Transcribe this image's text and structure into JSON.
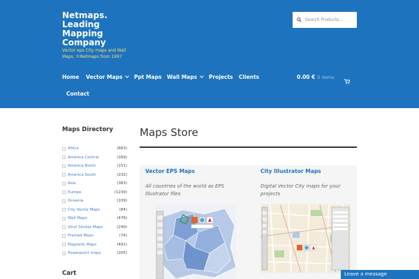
{
  "header": {
    "site_title": "Netmaps. Leading Mapping Company",
    "site_description": "Vector eps City maps and Wall Maps. ©Netmaps from 1997",
    "search_placeholder": "Search Products…"
  },
  "nav": {
    "items": [
      {
        "label": "Home"
      },
      {
        "label": "Vector Maps"
      },
      {
        "label": "Ppt Maps"
      },
      {
        "label": "Wall Maps"
      },
      {
        "label": "Projects"
      },
      {
        "label": "Clients"
      },
      {
        "label": "Contact"
      }
    ],
    "cart_total": "0.00 €",
    "cart_items": "0 items"
  },
  "sidebar": {
    "title": "Maps Directory",
    "categories": [
      {
        "name": "Africa",
        "count": "(663)"
      },
      {
        "name": "America Central",
        "count": "(169)"
      },
      {
        "name": "America North",
        "count": "(151)"
      },
      {
        "name": "America South",
        "count": "(232)"
      },
      {
        "name": "Asia",
        "count": "(363)"
      },
      {
        "name": "Europe",
        "count": "(1239)"
      },
      {
        "name": "Oceania",
        "count": "(109)"
      },
      {
        "name": "City Vector Maps",
        "count": "(84)"
      },
      {
        "name": "Wall Maps",
        "count": "(476)"
      },
      {
        "name": "Vinyl Sticker Maps",
        "count": "(240)"
      },
      {
        "name": "Framed Maps",
        "count": "(74)"
      },
      {
        "name": "Magnetic Maps",
        "count": "(491)"
      },
      {
        "name": "Powerpoint maps",
        "count": "(205)"
      }
    ],
    "cart_title": "Cart"
  },
  "main": {
    "title": "Maps Store",
    "products": [
      {
        "title": "Vector EPS Maps",
        "description": "All countries of the world as EPS Illustrator files"
      },
      {
        "title": "City Illustrator Maps",
        "description": "Digital Vector City maps for your projects"
      }
    ]
  },
  "chat": {
    "label": "Leave a message"
  },
  "colors": {
    "brand_blue": "#1e73be",
    "tagline_yellow": "#f5e07a"
  }
}
